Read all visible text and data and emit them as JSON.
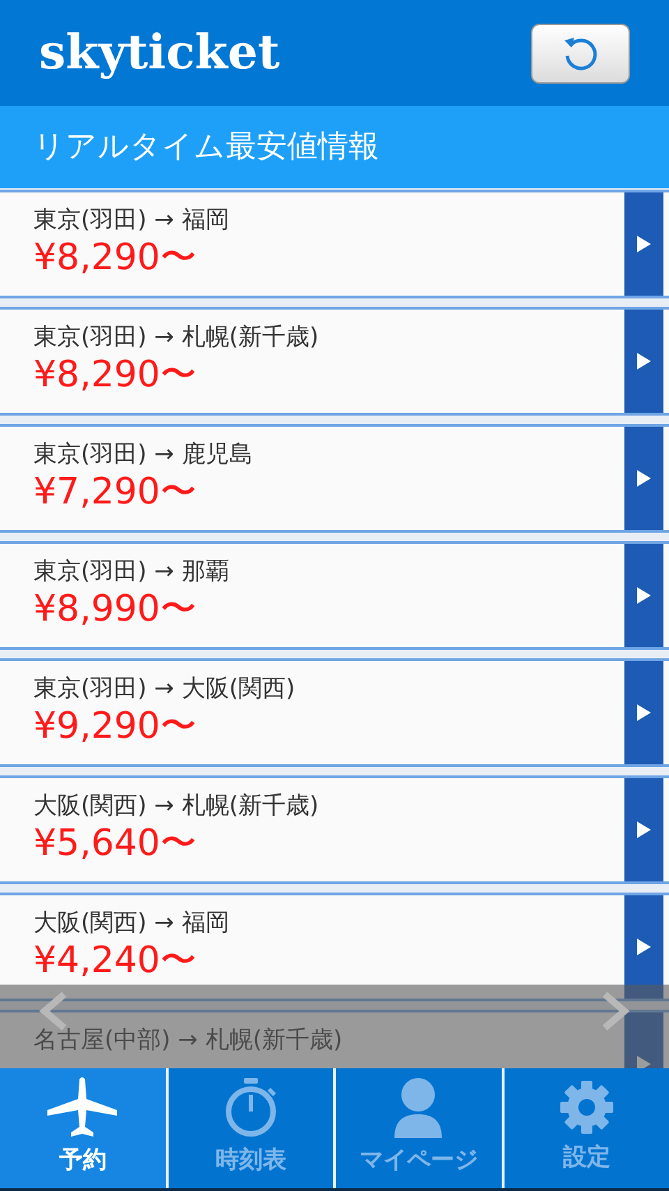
{
  "header": {
    "title": "skyticket"
  },
  "section": {
    "title": "リアルタイム最安値情報"
  },
  "routes": [
    {
      "route": "東京(羽田) → 福岡",
      "price": "¥8,290〜"
    },
    {
      "route": "東京(羽田) → 札幌(新千歳)",
      "price": "¥8,290〜"
    },
    {
      "route": "東京(羽田) → 鹿児島",
      "price": "¥7,290〜"
    },
    {
      "route": "東京(羽田) → 那覇",
      "price": "¥8,990〜"
    },
    {
      "route": "東京(羽田) → 大阪(関西)",
      "price": "¥9,290〜"
    },
    {
      "route": "大阪(関西) → 札幌(新千歳)",
      "price": "¥5,640〜"
    },
    {
      "route": "大阪(関西) → 福岡",
      "price": "¥4,240〜"
    },
    {
      "route": "名古屋(中部) → 札幌(新千歳)"
    }
  ],
  "tabs": [
    {
      "kind": "plane",
      "label": "予約",
      "selected": true
    },
    {
      "kind": "timer",
      "label": "時刻表",
      "selected": false
    },
    {
      "kind": "person",
      "label": "マイページ",
      "selected": false
    },
    {
      "kind": "gear",
      "label": "設定",
      "selected": false
    }
  ]
}
